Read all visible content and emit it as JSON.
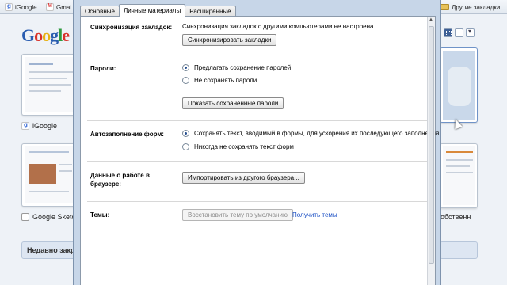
{
  "bookmarks_bar": {
    "items": [
      {
        "label": "iGoogle",
        "icon": "igoogle-favicon"
      },
      {
        "label": "Gmai",
        "icon": "gmail-favicon"
      }
    ],
    "other_bookmarks": "Другие закладки"
  },
  "ntp": {
    "logo": {
      "g1": "G",
      "o1": "o",
      "o2": "o",
      "g2": "g",
      "l": "l",
      "e": "e"
    },
    "thumbnails": [
      {
        "title": "iGoogle"
      },
      {
        "title": "Google Sketch"
      },
      {
        "title": "обственн"
      }
    ],
    "recently_closed": "Недавно закр"
  },
  "dialog": {
    "tabs": [
      {
        "label": "Основные",
        "selected": false
      },
      {
        "label": "Личные материалы",
        "selected": true
      },
      {
        "label": "Расширенные",
        "selected": false
      }
    ],
    "sync": {
      "label": "Синхронизация закладок:",
      "status": "Синхронизация закладок с другими компьютерами не настроена.",
      "button": "Синхронизировать закладки"
    },
    "passwords": {
      "label": "Пароли:",
      "options": [
        {
          "label": "Предлагать сохранение паролей",
          "checked": true
        },
        {
          "label": "Не сохранять пароли",
          "checked": false
        }
      ],
      "button": "Показать сохраненные пароли"
    },
    "autofill": {
      "label": "Автозаполнение форм:",
      "options": [
        {
          "label": "Сохранять текст, вводимый в формы, для ускорения их последующего заполнения.",
          "checked": true
        },
        {
          "label": "Никогда не сохранять текст форм",
          "checked": false
        }
      ]
    },
    "browsing_data": {
      "label": "Данные о работе в браузере:",
      "button": "Импортировать из другого браузера..."
    },
    "themes": {
      "label": "Темы:",
      "button": "Восстановить тему по умолчанию",
      "link": "Получить темы"
    }
  }
}
